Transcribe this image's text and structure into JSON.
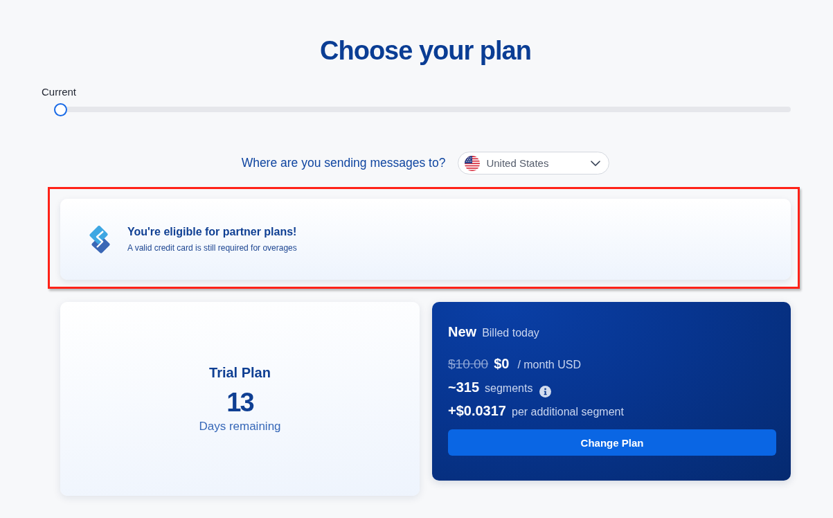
{
  "page": {
    "title": "Choose your plan"
  },
  "plan_slider": {
    "label": "Current",
    "level": 0
  },
  "destination": {
    "question": "Where are you sending messages to?",
    "country": "United States"
  },
  "partner_banner": {
    "title": "You're eligible for partner plans!",
    "subtitle": "A valid credit card is still required for overages",
    "highlighted": true
  },
  "current_plan": {
    "name": "Trial Plan",
    "days": "13",
    "caption": "Days remaining"
  },
  "new_plan": {
    "label": "New",
    "billing": "Billed today",
    "old_price": "$10.00",
    "price": "$0",
    "price_unit": "/ month USD",
    "segments": "~315",
    "segments_label": "segments",
    "overage": "+$0.0317",
    "overage_label": "per additional segment",
    "button": "Change Plan"
  }
}
